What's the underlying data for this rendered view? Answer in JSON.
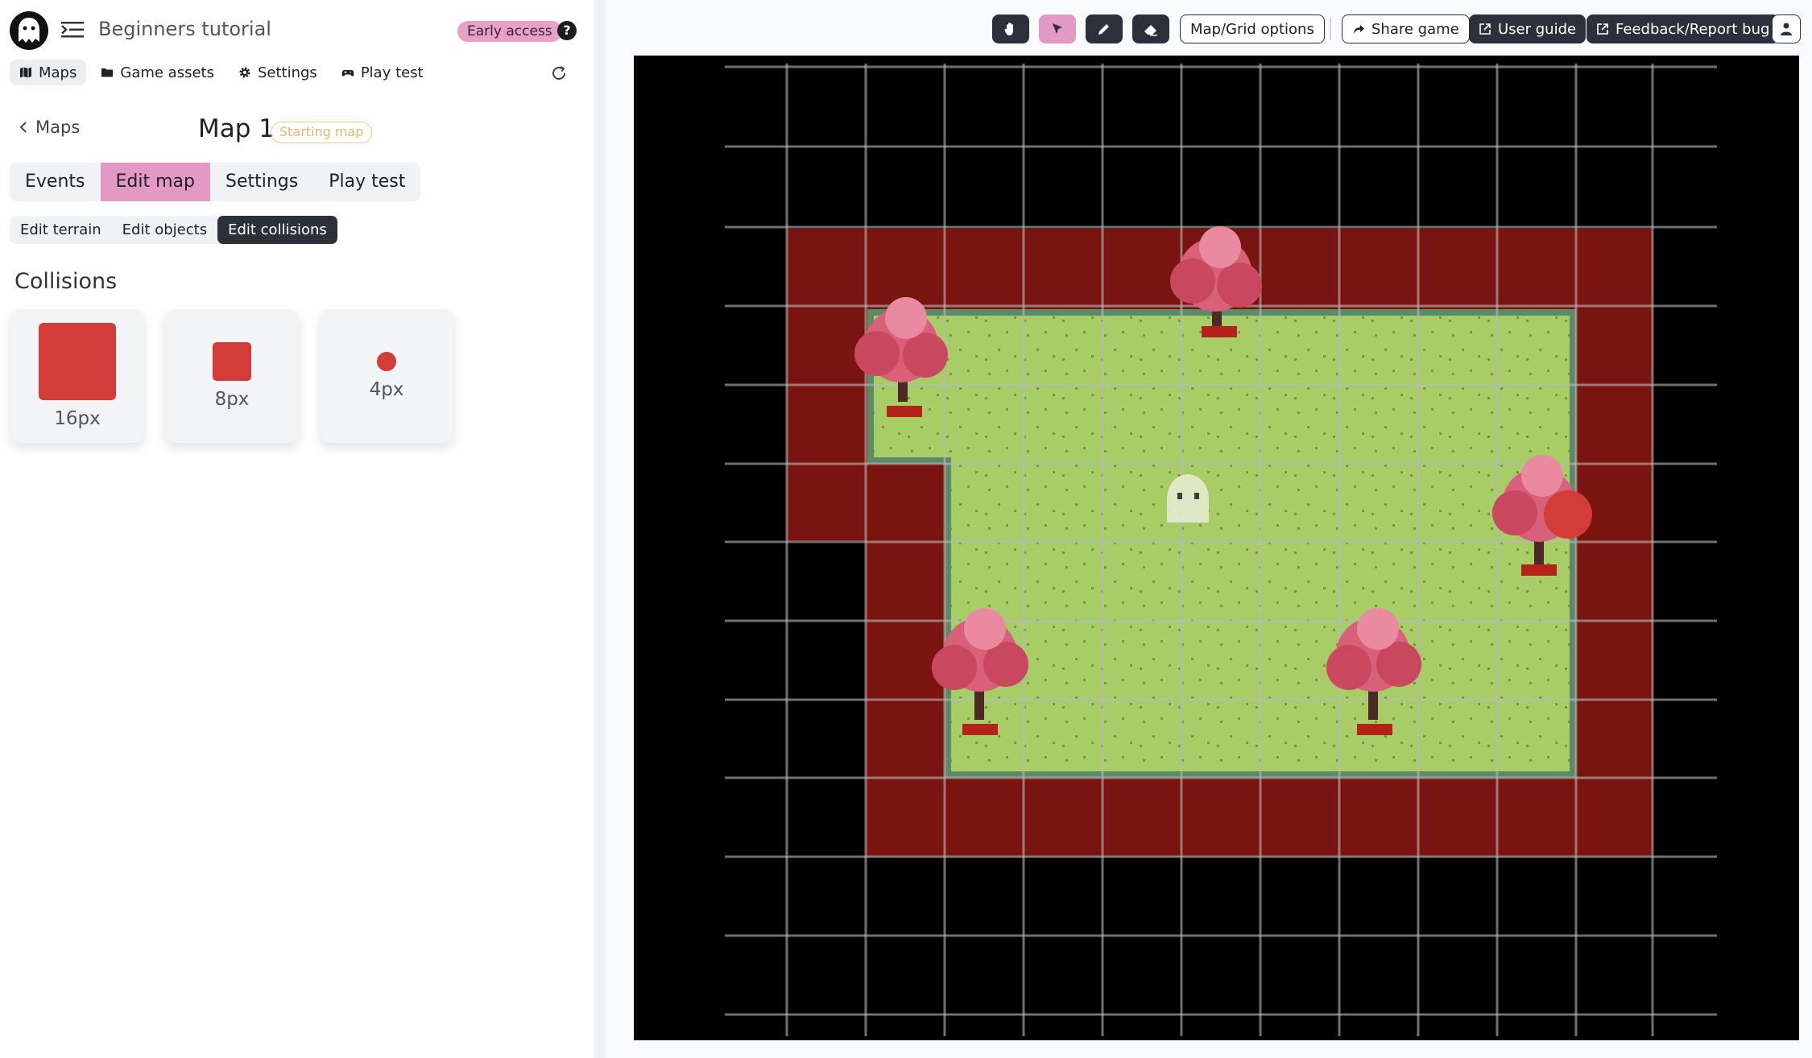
{
  "app": {
    "project_title": "Beginners tutorial",
    "early_access_label": "Early access",
    "help_label": "?"
  },
  "topnav": {
    "items": [
      {
        "label": "Maps",
        "icon": "map-icon",
        "active": true
      },
      {
        "label": "Game assets",
        "icon": "folder-icon",
        "active": false
      },
      {
        "label": "Settings",
        "icon": "gear-icon",
        "active": false
      },
      {
        "label": "Play test",
        "icon": "gamepad-icon",
        "active": false
      }
    ]
  },
  "breadcrumb": {
    "back_label": "Maps",
    "map_name": "Map 1",
    "map_badge": "Starting map"
  },
  "main_tabs": [
    {
      "label": "Events",
      "active": false
    },
    {
      "label": "Edit map",
      "active": true
    },
    {
      "label": "Settings",
      "active": false
    },
    {
      "label": "Play test",
      "active": false
    }
  ],
  "sub_tabs": [
    {
      "label": "Edit terrain",
      "active": false
    },
    {
      "label": "Edit objects",
      "active": false
    },
    {
      "label": "Edit collisions",
      "active": true
    }
  ],
  "collisions": {
    "title": "Collisions",
    "brushes": [
      {
        "label": "16px",
        "color": "#d33c38"
      },
      {
        "label": "8px",
        "color": "#d33c38"
      },
      {
        "label": "4px",
        "color": "#d33c38"
      }
    ]
  },
  "toolbar": {
    "tools": [
      {
        "name": "hand-tool",
        "icon": "hand-icon",
        "active": false
      },
      {
        "name": "select-tool",
        "icon": "cursor-icon",
        "active": true
      },
      {
        "name": "pencil-tool",
        "icon": "pencil-icon",
        "active": false
      },
      {
        "name": "eraser-tool",
        "icon": "eraser-icon",
        "active": false
      }
    ],
    "map_grid_options_label": "Map/Grid options",
    "share_game_label": "Share game",
    "user_guide_label": "User guide",
    "feedback_label": "Feedback/Report bug"
  },
  "colors": {
    "accent_pink": "#e29ac4",
    "dark": "#2b303a",
    "collision_red": "#7a1410",
    "grass": "#a8cc66",
    "tree_foliage": "#d8607a"
  }
}
